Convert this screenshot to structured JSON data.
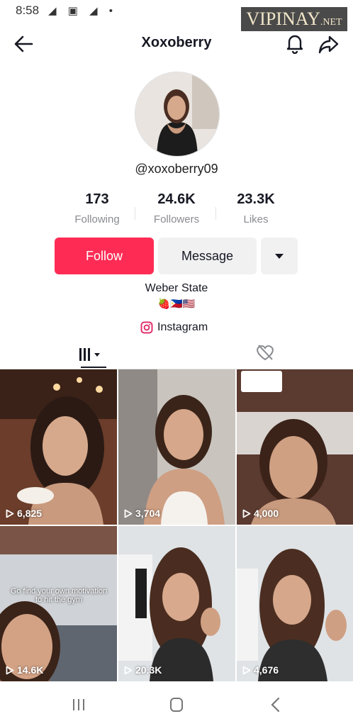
{
  "status_bar": {
    "time": "8:58",
    "icons": [
      "telegram-icon",
      "image-icon",
      "telegram-icon",
      "dot-icon"
    ]
  },
  "watermark": {
    "brand": "VIPINAY",
    "suffix": ".NET"
  },
  "header": {
    "title": "Xoxoberry"
  },
  "profile": {
    "username": "@xoxoberry09",
    "stats": [
      {
        "value": "173",
        "label": "Following"
      },
      {
        "value": "24.6K",
        "label": "Followers"
      },
      {
        "value": "23.3K",
        "label": "Likes"
      }
    ],
    "follow_label": "Follow",
    "message_label": "Message",
    "bio": "Weber State",
    "bio_emoji": "🍓🇵🇭🇺🇸",
    "instagram_label": "Instagram"
  },
  "colors": {
    "accent": "#fe2c55",
    "secondary_button": "#f1f1f2",
    "muted_text": "#8a8b91"
  },
  "videos": [
    {
      "views": "6,825",
      "caption": ""
    },
    {
      "views": "3,704",
      "caption": ""
    },
    {
      "views": "4,000",
      "caption": ""
    },
    {
      "views": "14.6K",
      "caption": "Go find your own motivation to hit the gym"
    },
    {
      "views": "20.3K",
      "caption": ""
    },
    {
      "views": "4,676",
      "caption": ""
    }
  ]
}
